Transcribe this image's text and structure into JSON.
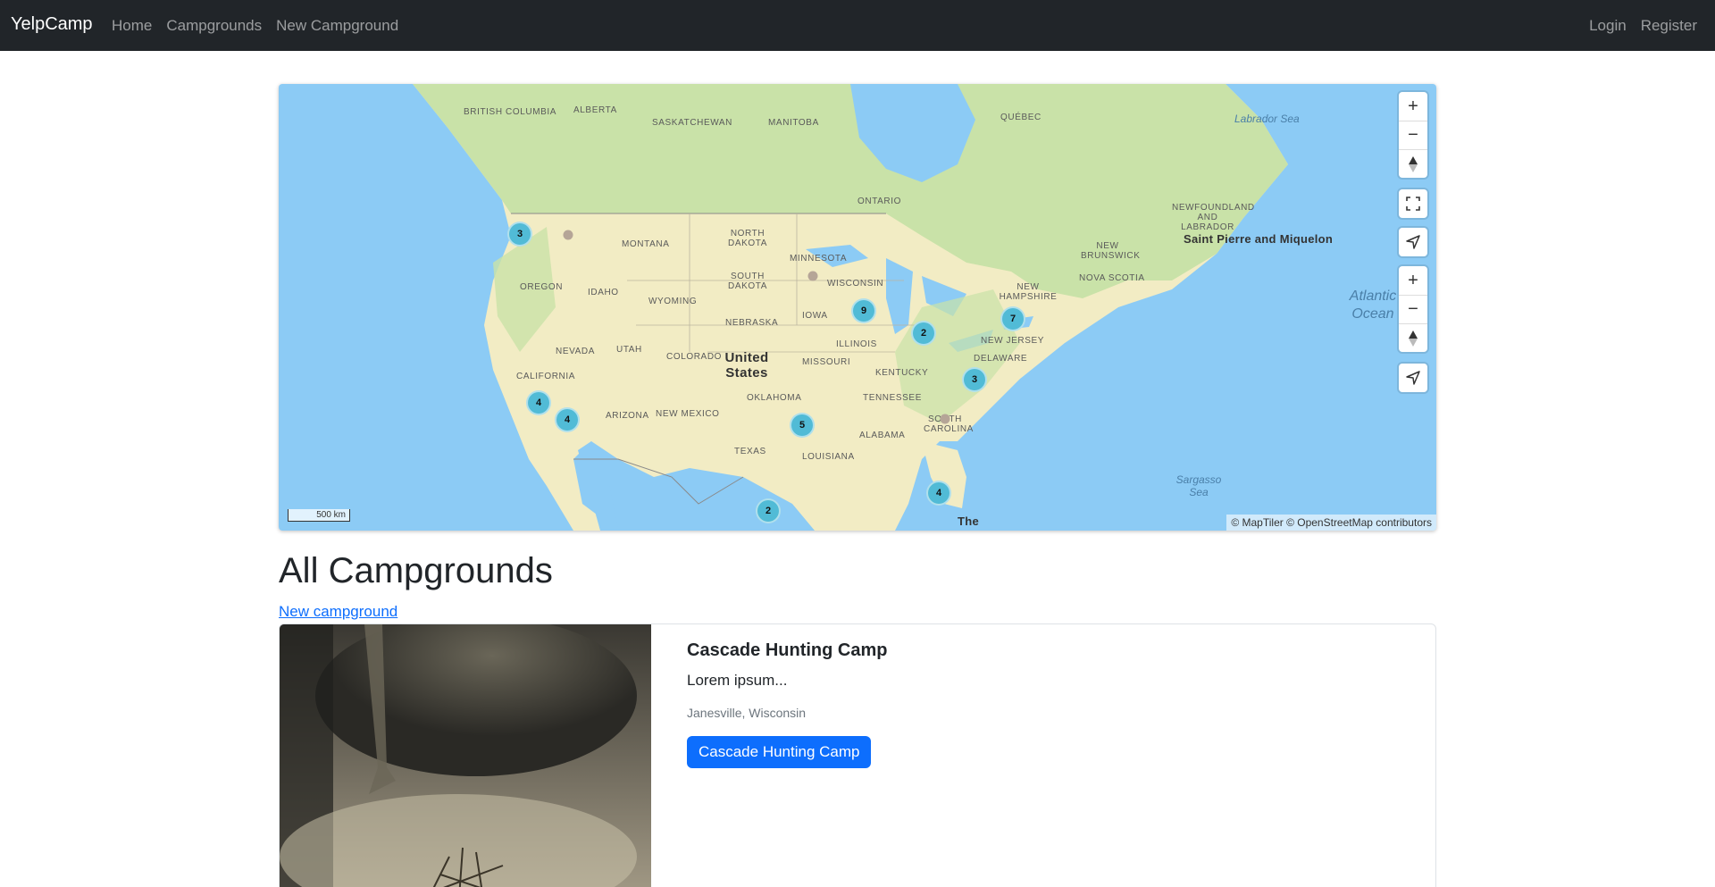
{
  "navbar": {
    "brand": "YelpCamp",
    "links": [
      "Home",
      "Campgrounds",
      "New Campground"
    ],
    "right_links": [
      "Login",
      "Register"
    ]
  },
  "map": {
    "labels": {
      "british_columbia": "British Columbia",
      "alberta": "Alberta",
      "saskatchewan": "Saskatchewan",
      "manitoba": "Manitoba",
      "quebec": "Québec",
      "ontario": "Ontario",
      "labrador_sea": "Labrador Sea",
      "newfoundland": "Newfoundland and Labrador",
      "saint_pierre": "Saint Pierre and Miquelon",
      "new_brunswick": "New Brunswick",
      "nova_scotia": "Nova Scotia",
      "montana": "Montana",
      "north_dakota": "North Dakota",
      "minnesota": "Minnesota",
      "oregon": "Oregon",
      "idaho": "Idaho",
      "wyoming": "Wyoming",
      "south_dakota": "South Dakota",
      "wisconsin": "Wisconsin",
      "new_hampshire": "New Hampshire",
      "nebraska": "Nebraska",
      "iowa": "Iowa",
      "nevada": "Nevada",
      "utah": "Utah",
      "colorado": "Colorado",
      "illinois": "Illinois",
      "new_jersey": "New Jersey",
      "delaware": "Delaware",
      "california": "California",
      "united_states": "United States",
      "missouri": "Missouri",
      "kentucky": "Kentucky",
      "oklahoma": "Oklahoma",
      "tennessee": "Tennessee",
      "arizona": "Arizona",
      "new_mexico": "New Mexico",
      "south_carolina": "South Carolina",
      "alabama": "Alabama",
      "louisiana": "Louisiana",
      "texas": "Texas",
      "atlantic_ocean": "Atlantic Ocean",
      "sargasso_sea": "Sargasso Sea",
      "the": "The"
    },
    "clusters": [
      "3",
      "9",
      "2",
      "7",
      "3",
      "4",
      "4",
      "5",
      "4",
      "2"
    ],
    "scale_label": "500 km",
    "attribution": "© MapTiler © OpenStreetMap contributors",
    "controls": [
      "zoom-in",
      "zoom-out",
      "compass",
      "fullscreen",
      "geolocate",
      "zoom-in",
      "zoom-out",
      "compass",
      "geolocate"
    ]
  },
  "main": {
    "title": "All Campgrounds",
    "new_link": "New campground"
  },
  "campgrounds": [
    {
      "title": "Cascade Hunting Camp",
      "description": "Lorem ipsum...",
      "location": "Janesville, Wisconsin",
      "button": "Cascade Hunting Camp"
    }
  ],
  "colors": {
    "navbar_bg": "#212529",
    "primary": "#0d6efd",
    "cluster": "#51bbd6",
    "water": "#8ccbf5",
    "land": "#f2ecc4"
  }
}
